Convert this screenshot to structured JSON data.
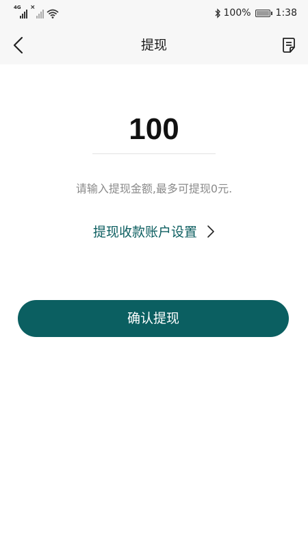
{
  "status_bar": {
    "network_label": "4G",
    "battery_percent": "100%",
    "time": "1:38",
    "icons": [
      "signal-icon",
      "no-signal-icon",
      "wifi-icon",
      "bluetooth-icon",
      "battery-icon"
    ]
  },
  "nav": {
    "title": "提现",
    "back_icon": "chevron-left-icon",
    "record_icon": "document-icon"
  },
  "withdraw": {
    "amount_value": "100",
    "hint": "请输入提现金额,最多可提现0元.",
    "account_link_label": "提现收款账户设置",
    "confirm_label": "确认提现"
  },
  "colors": {
    "accent": "#0b5f61",
    "link": "#0c5e60",
    "hint": "#8a8a8a",
    "bar_bg": "#f7f7f7"
  }
}
